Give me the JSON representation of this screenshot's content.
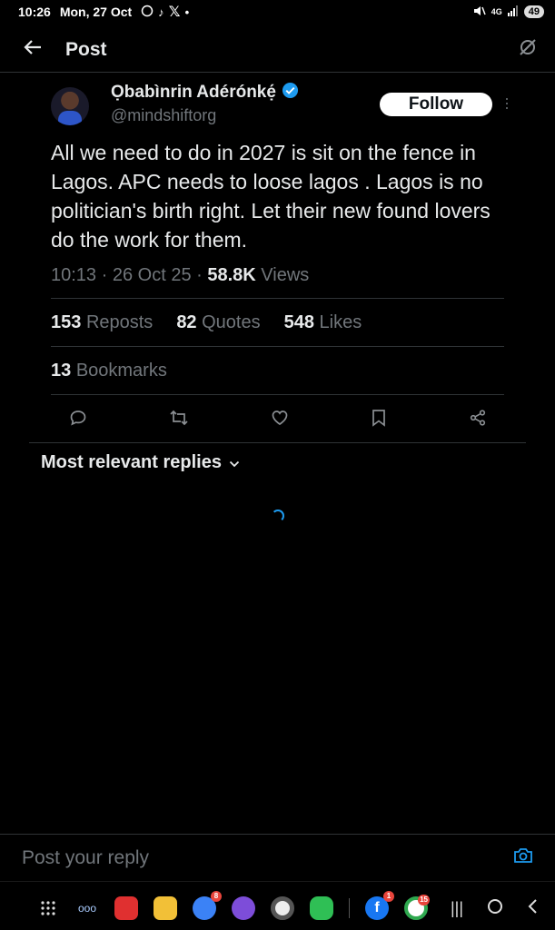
{
  "status_bar": {
    "time": "10:26",
    "date": "Mon, 27 Oct",
    "battery": "49",
    "network": "4G"
  },
  "header": {
    "title": "Post"
  },
  "tweet": {
    "display_name": "Ọbabìnrin Adérónkẹ́",
    "handle": "@mindshiftorg",
    "follow_label": "Follow",
    "text": "All we need to do in 2027 is sit on the fence in Lagos. APC needs to loose lagos . Lagos is no politician's birth right.  Let their new found lovers do the work for them.",
    "time": "10:13",
    "date": "26 Oct 25",
    "views_count": "58.8K",
    "views_label": "Views",
    "reposts_count": "153",
    "reposts_label": "Reposts",
    "quotes_count": "82",
    "quotes_label": "Quotes",
    "likes_count": "548",
    "likes_label": "Likes",
    "bookmarks_count": "13",
    "bookmarks_label": "Bookmarks"
  },
  "replies": {
    "sort_label": "Most relevant replies"
  },
  "reply_bar": {
    "placeholder": "Post your reply"
  },
  "nav": {
    "badges": {
      "messages": "8",
      "facebook": "1",
      "app": "15"
    }
  },
  "colors": {
    "background": "#000000",
    "accent": "#1d9bf0",
    "text_primary": "#e7e9ea",
    "text_secondary": "#71767b",
    "divider": "#2f3336"
  }
}
